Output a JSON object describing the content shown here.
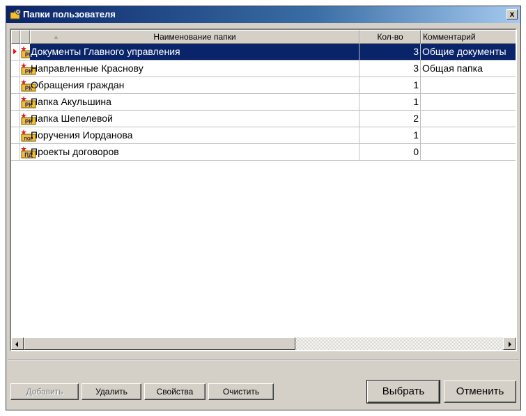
{
  "window": {
    "title": "Папки пользователя",
    "close_label": "x"
  },
  "columns": {
    "name": "Наименование папки",
    "count": "Кол-во",
    "comment": "Комментарий"
  },
  "rows": [
    {
      "icon": "РК",
      "icon_name": "folder-rk-icon",
      "name": "Документы Главного управления",
      "count": "3",
      "comment": "Общие документы",
      "selected": true
    },
    {
      "icon": "РК",
      "icon_name": "folder-rk-icon",
      "name": "Направленные Краснову",
      "count": "3",
      "comment": "Общая папка"
    },
    {
      "icon": "РК",
      "icon_name": "folder-rk-icon",
      "name": "Обращения граждан",
      "count": "1",
      "comment": ""
    },
    {
      "icon": "РК",
      "icon_name": "folder-rk-icon",
      "name": "Папка Акульшина",
      "count": "1",
      "comment": ""
    },
    {
      "icon": "РК",
      "icon_name": "folder-rk-icon",
      "name": "Папка Шепелевой",
      "count": "2",
      "comment": ""
    },
    {
      "icon": "ПОР",
      "icon_name": "folder-por-icon",
      "name": "Поручения Иорданова",
      "count": "1",
      "comment": ""
    },
    {
      "icon": "ПД",
      "icon_name": "folder-pd-icon",
      "name": "Проекты договоров",
      "count": "0",
      "comment": ""
    }
  ],
  "buttons": {
    "add": "Добавить",
    "delete": "Удалить",
    "properties": "Свойства",
    "clear": "Очистить",
    "select": "Выбрать",
    "cancel": "Отменить"
  },
  "colors": {
    "title_start": "#0a246a",
    "title_end": "#a6caf0",
    "selection": "#0a246a",
    "pointer": "#ff0000",
    "folder": "#f0c030"
  }
}
